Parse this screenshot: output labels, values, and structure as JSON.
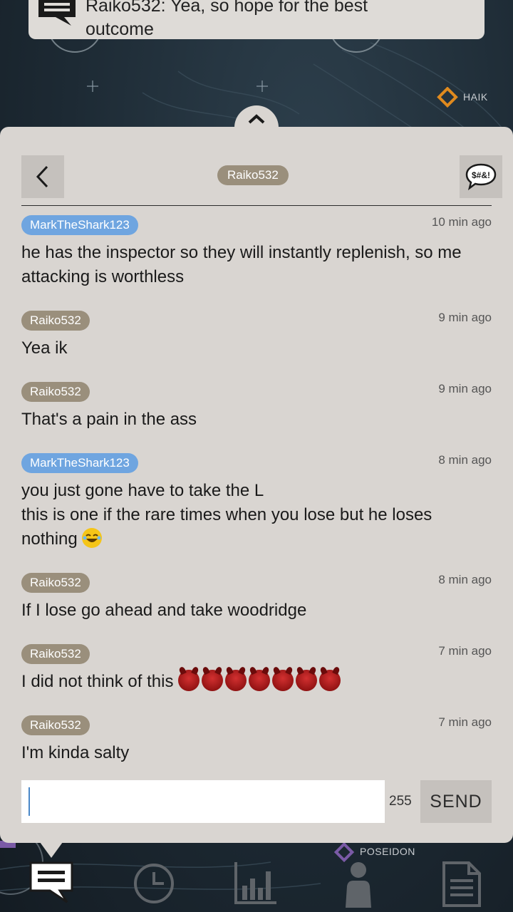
{
  "notification": {
    "hidden_line": "Raiko532: Yea, so hope for the best",
    "text": "outcome"
  },
  "map": {
    "labels": {
      "haik": "HAIK",
      "poseidon": "POSEIDON"
    }
  },
  "chat": {
    "title": "Raiko532",
    "back_icon": "back-arrow-icon",
    "filter_icon": "profanity-filter-icon",
    "filter_label": "$#&!",
    "messages": [
      {
        "author": "MarkTheShark123",
        "author_color": "#6fa5e0",
        "time": "10 min ago",
        "lines": [
          "he has the inspector so they will instantly replenish, so me attacking is worthless"
        ]
      },
      {
        "author": "Raiko532",
        "author_color": "#9a8f7c",
        "time": "9 min ago",
        "lines": [
          "Yea ik"
        ]
      },
      {
        "author": "Raiko532",
        "author_color": "#9a8f7c",
        "time": "9 min ago",
        "lines": [
          "That's a pain in the ass"
        ]
      },
      {
        "author": "MarkTheShark123",
        "author_color": "#6fa5e0",
        "time": "8 min ago",
        "lines": [
          "you just gone have to take the L",
          "this is one if the rare times when you lose but he loses nothing"
        ],
        "emoji": "laughing-emoji"
      },
      {
        "author": "Raiko532",
        "author_color": "#9a8f7c",
        "time": "8 min ago",
        "lines": [
          "If I lose go ahead and take woodridge"
        ]
      },
      {
        "author": "Raiko532",
        "author_color": "#9a8f7c",
        "time": "7 min ago",
        "lines": [
          "I did not think of this"
        ],
        "emoji": "demon-emoji",
        "emoji_count": 7
      },
      {
        "author": "Raiko532",
        "author_color": "#9a8f7c",
        "time": "7 min ago",
        "lines": [
          "I'm kinda salty"
        ]
      }
    ],
    "composer": {
      "value": "",
      "placeholder": "",
      "remaining_chars": "255",
      "send_label": "SEND"
    }
  },
  "nav": {
    "items": [
      {
        "icon": "chat-icon",
        "active": true
      },
      {
        "icon": "clock-icon",
        "active": false
      },
      {
        "icon": "stats-icon",
        "active": false
      },
      {
        "icon": "profile-icon",
        "active": false
      },
      {
        "icon": "document-icon",
        "active": false
      }
    ]
  },
  "colors": {
    "panel": "#d9d5d1",
    "button": "#c5c1bd",
    "chip_self": "#9a8f7c",
    "chip_other": "#6fa5e0",
    "map_accent": "#e08a1e",
    "poseidon_accent": "#7a5aa6"
  }
}
